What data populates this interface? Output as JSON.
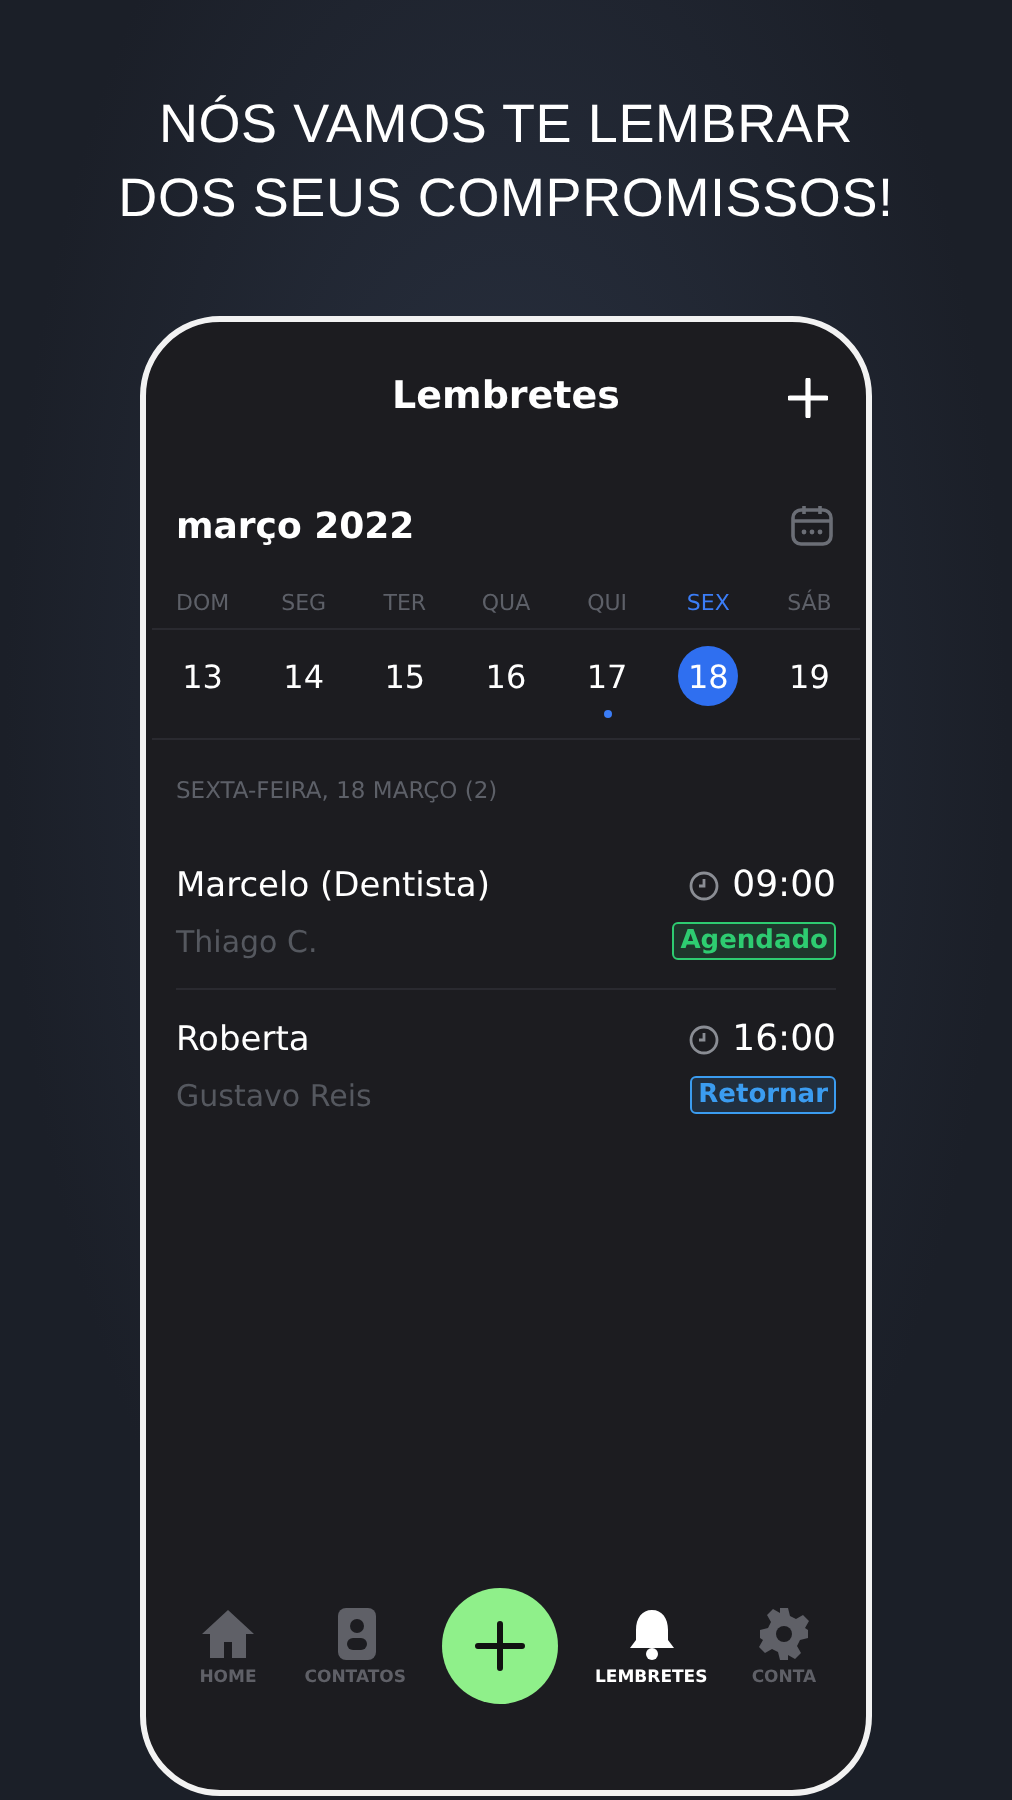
{
  "headline": [
    "NÓS VAMOS TE LEMBRAR",
    "DOS SEUS COMPROMISSOS!"
  ],
  "screen": {
    "title": "Lembretes",
    "month": "março 2022",
    "days": [
      {
        "weekday": "DOM",
        "date": "13",
        "selected": false,
        "has_event": false
      },
      {
        "weekday": "SEG",
        "date": "14",
        "selected": false,
        "has_event": false
      },
      {
        "weekday": "TER",
        "date": "15",
        "selected": false,
        "has_event": false
      },
      {
        "weekday": "QUA",
        "date": "16",
        "selected": false,
        "has_event": false
      },
      {
        "weekday": "QUI",
        "date": "17",
        "selected": false,
        "has_event": true
      },
      {
        "weekday": "SEX",
        "date": "18",
        "selected": true,
        "has_event": false
      },
      {
        "weekday": "SÁB",
        "date": "19",
        "selected": false,
        "has_event": false
      }
    ],
    "section_label": "SEXTA-FEIRA, 18 MARÇO (2)",
    "reminders": [
      {
        "name": "Marcelo (Dentista)",
        "contact": "Thiago C.",
        "time": "09:00",
        "status": "Agendado",
        "color": "#2ecc71"
      },
      {
        "name": "Roberta",
        "contact": "Gustavo Reis",
        "time": "16:00",
        "status": "Retornar",
        "color": "#3b9cf0"
      }
    ],
    "nav": [
      {
        "kind": "home",
        "label": "HOME",
        "selected": false
      },
      {
        "kind": "contacts",
        "label": "CONTATOS",
        "selected": false
      },
      {
        "kind": "add"
      },
      {
        "kind": "bell",
        "label": "LEMBRETES",
        "selected": true
      },
      {
        "kind": "gear",
        "label": "CONTA",
        "selected": false
      }
    ]
  }
}
